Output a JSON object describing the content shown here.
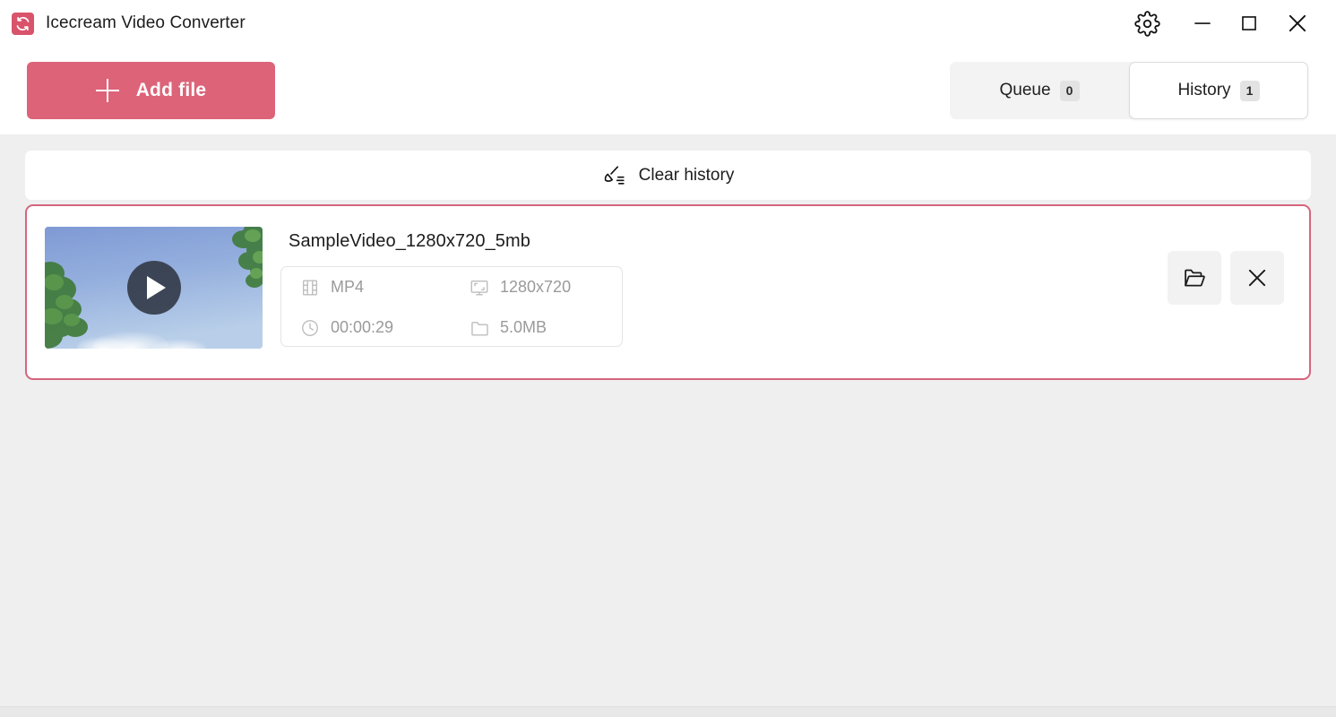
{
  "window": {
    "title": "Icecream Video Converter",
    "logo_icon": "convert-refresh-icon",
    "controls": [
      {
        "name": "settings-gear-button",
        "icon": "gear-icon",
        "label": ""
      },
      {
        "name": "minimize-button",
        "icon": "minimize-icon",
        "label": ""
      },
      {
        "name": "maximize-button",
        "icon": "maximize-icon",
        "label": ""
      },
      {
        "name": "close-button",
        "icon": "close-icon",
        "label": ""
      }
    ]
  },
  "toolbar": {
    "add_file_label": "Add file",
    "add_file_icon": "plus-icon",
    "accent_color": "#dd6378"
  },
  "tabs": [
    {
      "label": "Queue",
      "count": "0",
      "active": false
    },
    {
      "label": "History",
      "count": "1",
      "active": true
    }
  ],
  "clear_history": {
    "label": "Clear history",
    "icon": "broom-sweep-icon"
  },
  "files": [
    {
      "name": "SampleVideo_1280x720_5mb",
      "thumbnail_alt": "blue-sky-with-foliage-video-frame",
      "play_icon": "play-icon",
      "meta": [
        {
          "icon": "film-strip-icon",
          "key": "format",
          "value": "MP4"
        },
        {
          "icon": "monitor-resolution-icon",
          "key": "resolution",
          "value": "1280x720"
        },
        {
          "icon": "clock-icon",
          "key": "duration",
          "value": "00:00:29"
        },
        {
          "icon": "folder-icon",
          "key": "size",
          "value": "5.0MB"
        }
      ],
      "actions": [
        {
          "name": "open-folder-button",
          "icon": "open-folder-icon"
        },
        {
          "name": "remove-file-button",
          "icon": "close-icon"
        }
      ],
      "highlight_color": "#d4657e"
    }
  ]
}
